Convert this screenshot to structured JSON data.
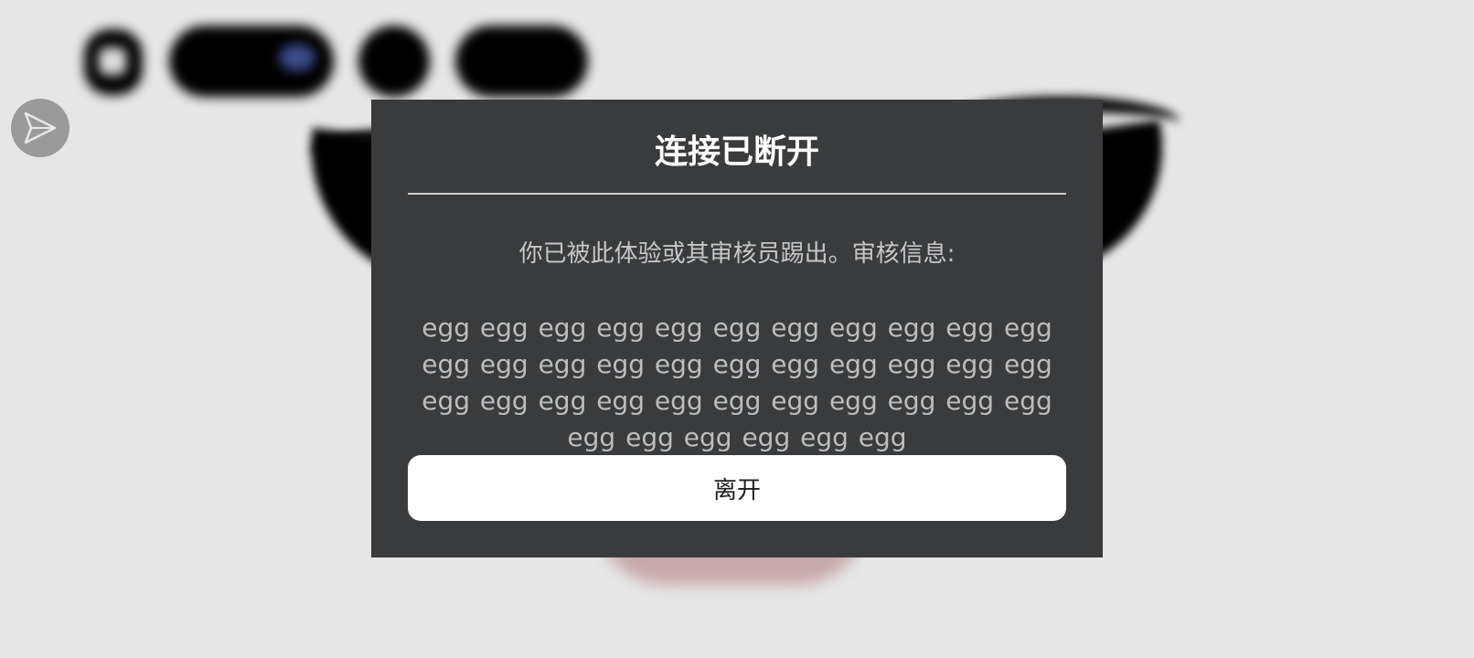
{
  "dialog": {
    "title": "连接已断开",
    "message": "你已被此体验或其审核员踢出。审核信息:",
    "reason": "egg egg egg egg egg egg egg egg egg egg egg egg egg egg egg egg egg egg egg egg egg egg egg egg egg egg egg egg egg egg egg egg egg egg egg egg egg egg egg",
    "leave_label": "离开"
  },
  "icons": {
    "send": "send-arrow-icon"
  },
  "colors": {
    "background": "#e6e6e6",
    "modal": "#3a3b3d",
    "button": "#ffffff"
  }
}
